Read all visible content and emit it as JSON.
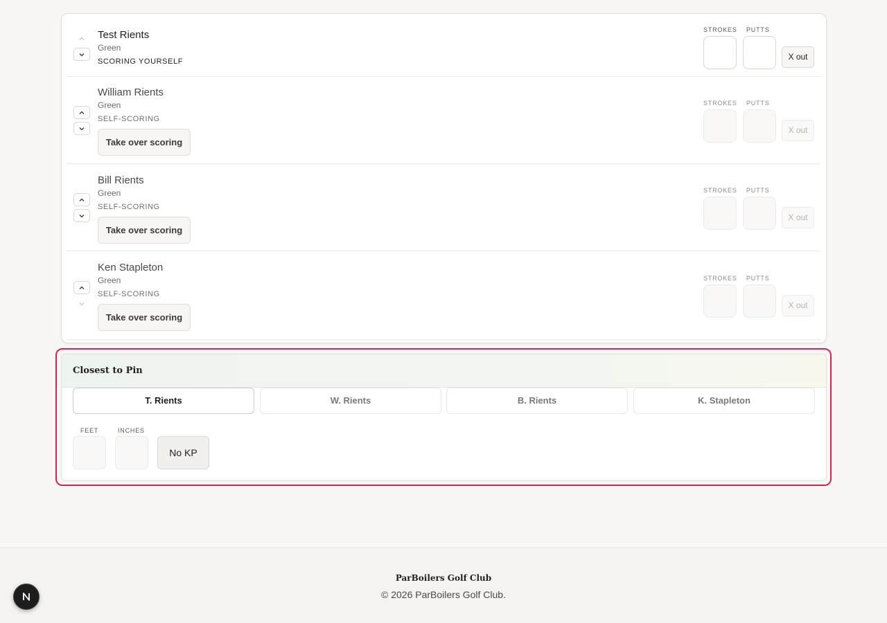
{
  "players": [
    {
      "name": "Test Rients",
      "tee": "Green",
      "status": "SCORING YOURSELF",
      "strokes_label": "STROKES",
      "putts_label": "PUTTS",
      "xout_label": "X out"
    },
    {
      "name": "William Rients",
      "tee": "Green",
      "status": "SELF-SCORING",
      "takeover_label": "Take over scoring",
      "strokes_label": "STROKES",
      "putts_label": "PUTTS",
      "xout_label": "X out"
    },
    {
      "name": "Bill Rients",
      "tee": "Green",
      "status": "SELF-SCORING",
      "takeover_label": "Take over scoring",
      "strokes_label": "STROKES",
      "putts_label": "PUTTS",
      "xout_label": "X out"
    },
    {
      "name": "Ken Stapleton",
      "tee": "Green",
      "status": "SELF-SCORING",
      "takeover_label": "Take over scoring",
      "strokes_label": "STROKES",
      "putts_label": "PUTTS",
      "xout_label": "X out"
    }
  ],
  "closest_to_pin": {
    "title": "Closest to Pin",
    "tabs": [
      {
        "label": "T. Rients",
        "active": true
      },
      {
        "label": "W. Rients",
        "active": false
      },
      {
        "label": "B. Rients",
        "active": false
      },
      {
        "label": "K. Stapleton",
        "active": false
      }
    ],
    "feet_label": "FEET",
    "inches_label": "INCHES",
    "nokp_label": "No KP",
    "highlight_color": "#d6245a"
  },
  "footer": {
    "club_name": "ParBoilers Golf Club",
    "copyright": "© 2026 ParBoilers Golf Club."
  },
  "badge": {
    "icon": "nextjs-n-icon"
  }
}
